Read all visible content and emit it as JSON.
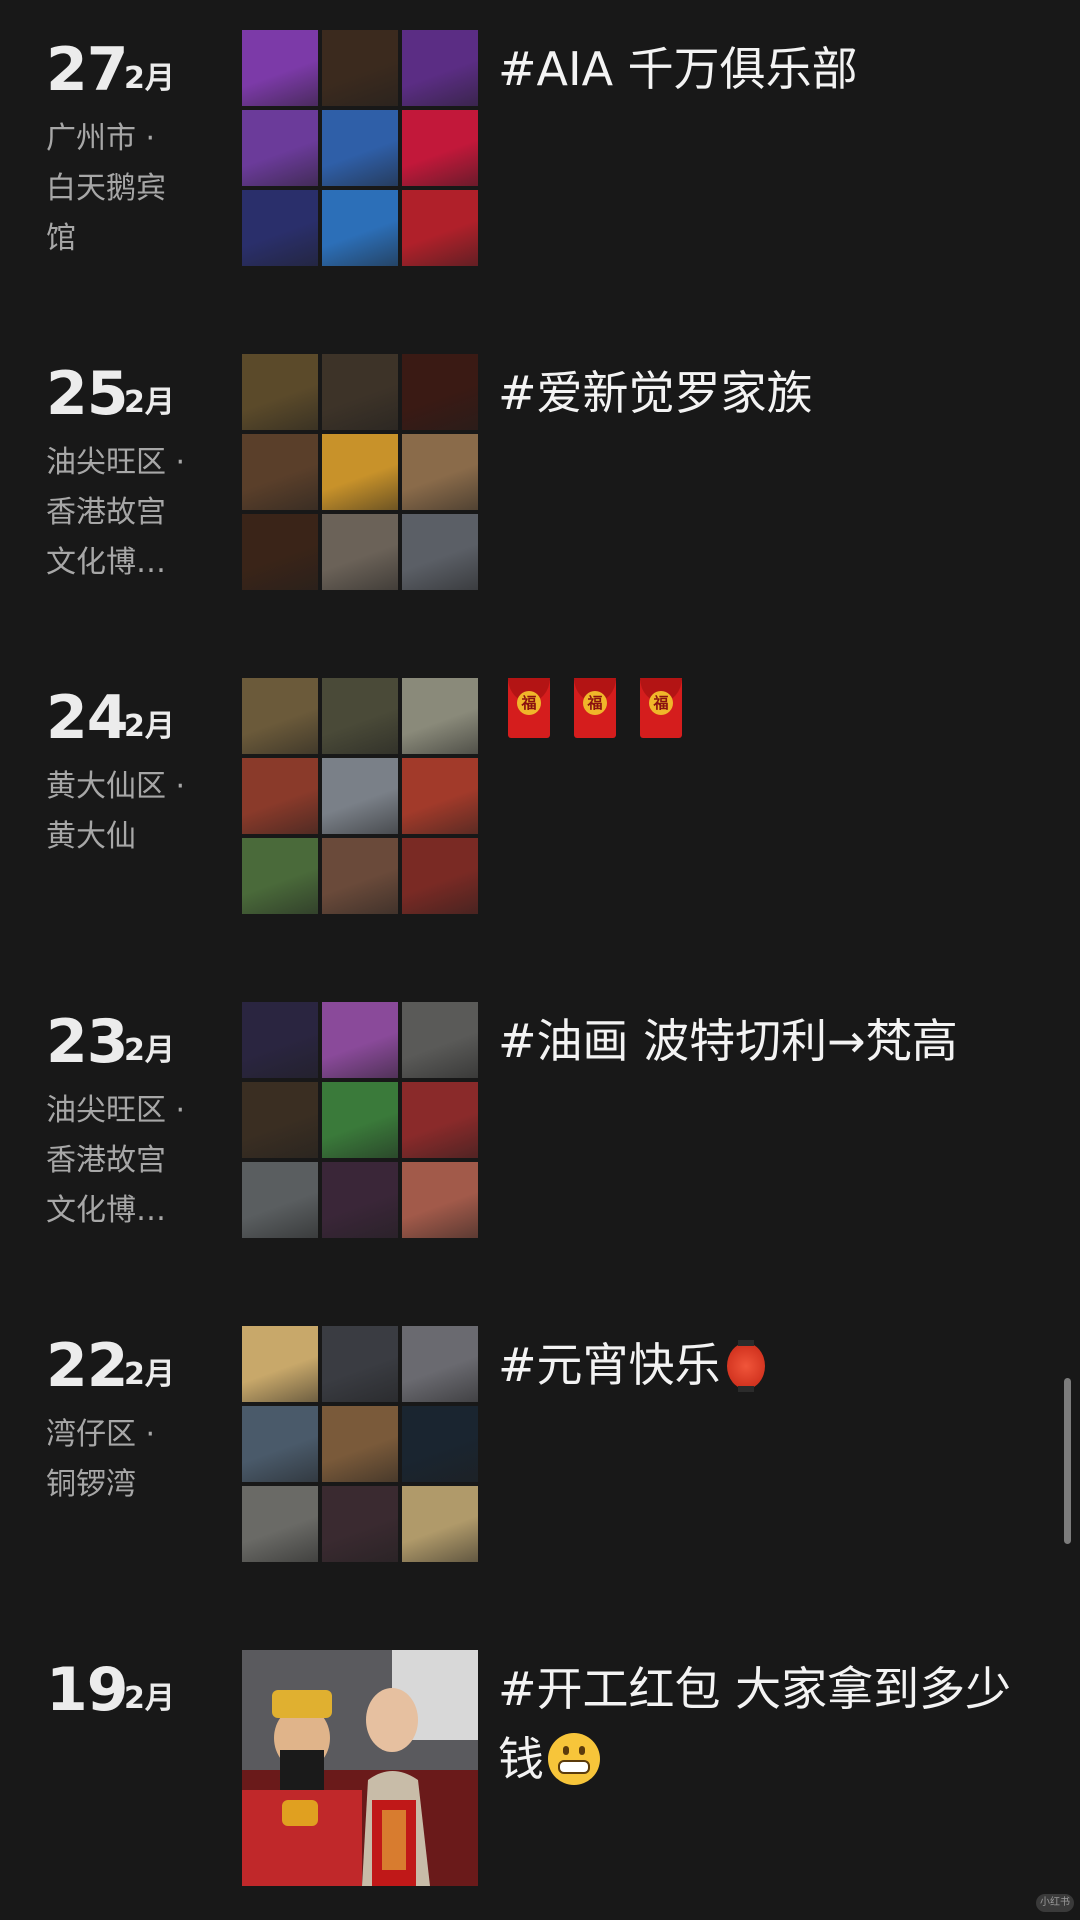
{
  "entries": [
    {
      "day": "27",
      "month": "2月",
      "location": "广州市 ·\n白天鹅宾\n馆",
      "caption": "#AIA 千万俱乐部",
      "photo_colors": [
        "#7c3aa8",
        "#3b2a1e",
        "#5b2d84",
        "#6b3b9a",
        "#2f5fa8",
        "#c2183a",
        "#2a2f6b",
        "#2c6fb8",
        "#b0202a"
      ]
    },
    {
      "day": "25",
      "month": "2月",
      "location": "油尖旺区 ·\n 香港故宫\n文化博…",
      "caption": "#爱新觉罗家族",
      "photo_colors": [
        "#5b4a2a",
        "#3d3328",
        "#3a1a14",
        "#5a3f2a",
        "#c8922a",
        "#8a6b4a",
        "#3a2418",
        "#6b6258",
        "#5b5f66"
      ]
    },
    {
      "day": "24",
      "month": "2月",
      "location": "黄大仙区 ·\n 黄大仙",
      "caption": "",
      "envelope_glyph": "福",
      "envelopes": 3,
      "photo_colors": [
        "#6b5a3a",
        "#4a4a38",
        "#8a8a7a",
        "#8a3a2a",
        "#7a8088",
        "#a23a2a",
        "#4a6a3a",
        "#6a4a3a",
        "#7a2a24"
      ]
    },
    {
      "day": "23",
      "month": "2月",
      "location": "油尖旺区 ·\n 香港故宫\n文化博…",
      "caption": "#油画 波特切利→梵高",
      "photo_colors": [
        "#2a2540",
        "#8a4a9a",
        "#5a5a58",
        "#3a2e22",
        "#3a7a3a",
        "#8a2a2a",
        "#5a5e60",
        "#3a2638",
        "#a25a4a"
      ]
    },
    {
      "day": "22",
      "month": "2月",
      "location": "湾仔区 ·\n铜锣湾",
      "caption": "#元宵快乐",
      "photo_colors": [
        "#c8a86a",
        "#3a3c42",
        "#6a6a70",
        "#4a5a6a",
        "#7a5a3a",
        "#1a2530",
        "#6a6a66",
        "#3a2a30",
        "#b09a6a"
      ]
    },
    {
      "day": "19",
      "month": "2月",
      "location": "",
      "caption": "#开工红包 大家拿到多少钱",
      "photo_colors": [
        "#b52a2a"
      ]
    }
  ],
  "watermark": "小红书",
  "icons": {
    "envelope": "red-envelope-icon",
    "lantern": "lantern-emoji-icon",
    "grin": "grinning-emoji-icon"
  }
}
